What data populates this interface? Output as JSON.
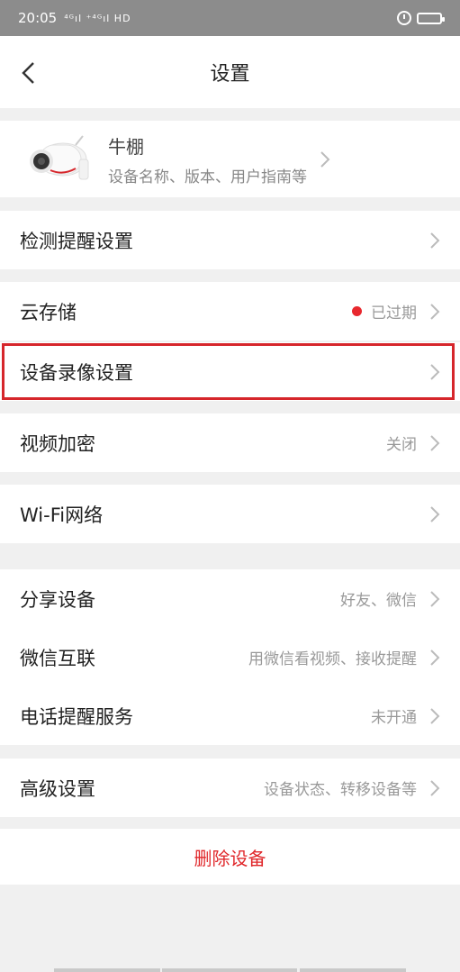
{
  "status_bar": {
    "time": "20:05",
    "signal": "⁴ᴳıl ⁺⁴ᴳıl HD",
    "battery_color": "#ffe100"
  },
  "header": {
    "title": "设置",
    "back_icon": "chevron-left-icon"
  },
  "device": {
    "name": "牛棚",
    "subtitle": "设备名称、版本、用户指南等"
  },
  "rows": {
    "detection": {
      "label": "检测提醒设置"
    },
    "cloud": {
      "label": "云存储",
      "value": "已过期",
      "status_color": "#e8282e"
    },
    "recording": {
      "label": "设备录像设置"
    },
    "encryption": {
      "label": "视频加密",
      "value": "关闭"
    },
    "wifi": {
      "label": "Wi-Fi网络"
    },
    "share": {
      "label": "分享设备",
      "value": "好友、微信"
    },
    "wechat": {
      "label": "微信互联",
      "value": "用微信看视频、接收提醒"
    },
    "phone": {
      "label": "电话提醒服务",
      "value": "未开通"
    },
    "advanced": {
      "label": "高级设置",
      "value": "设备状态、转移设备等"
    }
  },
  "delete_label": "删除设备",
  "colors": {
    "accent_red": "#e0282b",
    "highlight_border": "#d6262b"
  }
}
